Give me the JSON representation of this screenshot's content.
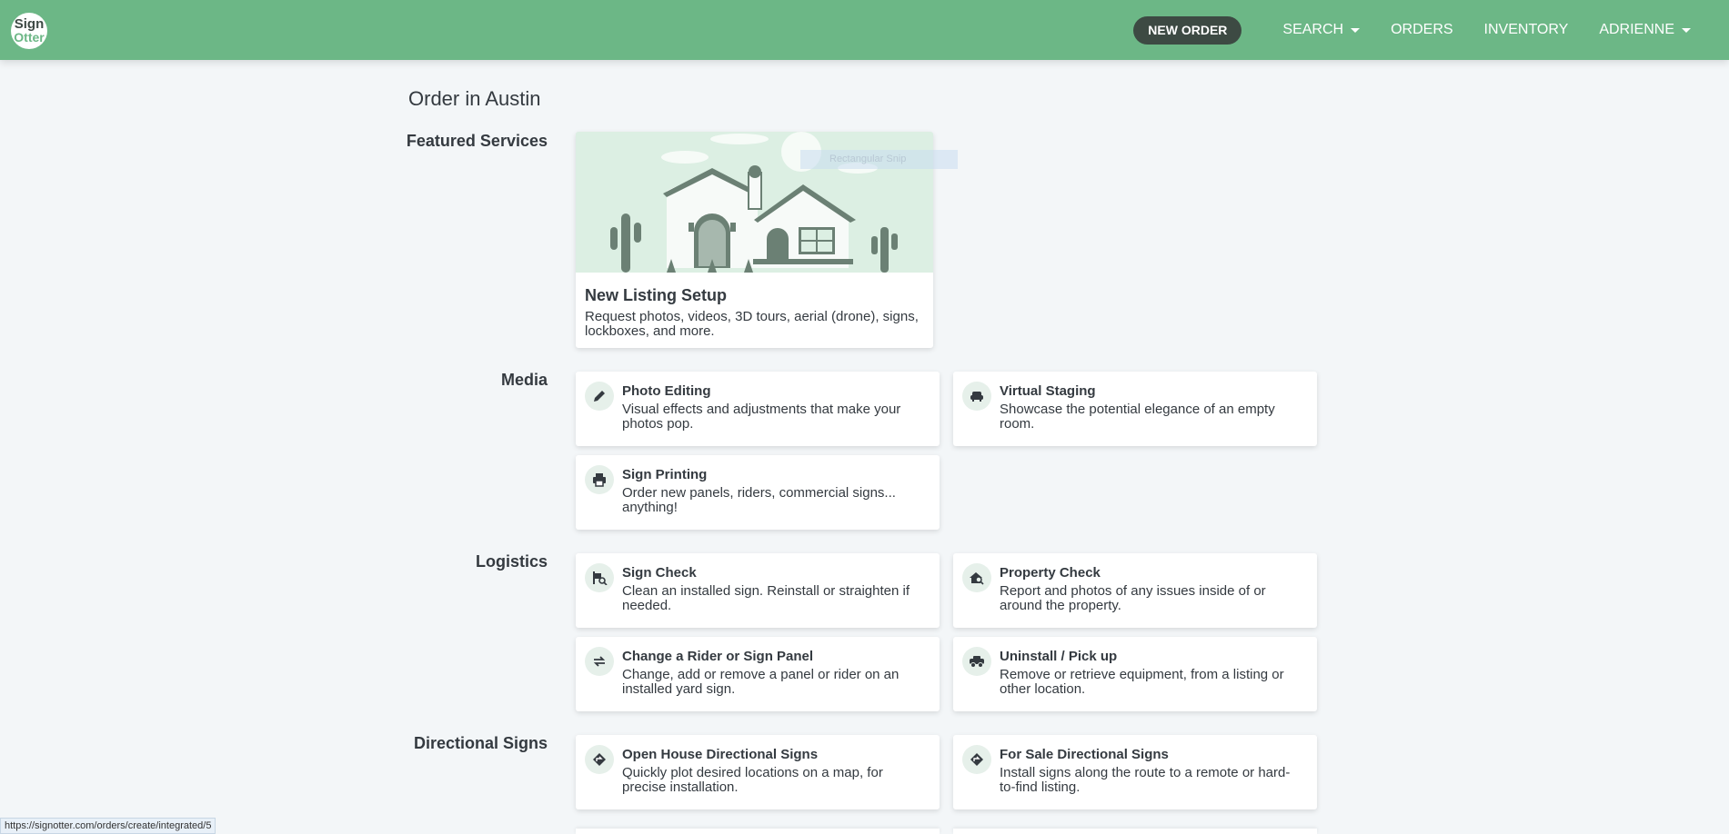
{
  "nav": {
    "logo_line1": "Sign",
    "logo_line2": "Otter",
    "new_order": "NEW ORDER",
    "search": "SEARCH",
    "orders": "ORDERS",
    "inventory": "INVENTORY",
    "user": "ADRIENNE"
  },
  "page": {
    "title": "Order in Austin"
  },
  "sections": {
    "featured": "Featured Services",
    "media": "Media",
    "logistics": "Logistics",
    "directional": "Directional Signs"
  },
  "featured": {
    "title": "New Listing Setup",
    "desc": "Request photos, videos, 3D tours, aerial (drone), signs, lockboxes, and more."
  },
  "overlay": {
    "snip": "Rectangular Snip"
  },
  "cards": {
    "photo_editing": {
      "title": "Photo Editing",
      "desc": "Visual effects and adjustments that make your photos pop.",
      "icon": "pencil-icon"
    },
    "virtual_staging": {
      "title": "Virtual Staging",
      "desc": "Showcase the potential elegance of an empty room.",
      "icon": "sofa-icon"
    },
    "sign_printing": {
      "title": "Sign Printing",
      "desc": "Order new panels, riders, commercial signs... anything!",
      "icon": "printer-icon"
    },
    "sign_check": {
      "title": "Sign Check",
      "desc": "Clean an installed sign. Reinstall or straighten if needed.",
      "icon": "sign-search-icon"
    },
    "property_check": {
      "title": "Property Check",
      "desc": "Report and photos of any issues inside of or around the property.",
      "icon": "house-search-icon"
    },
    "change_rider": {
      "title": "Change a Rider or Sign Panel",
      "desc": "Change, add or remove a panel or rider on an installed yard sign.",
      "icon": "swap-arrows-icon"
    },
    "uninstall": {
      "title": "Uninstall / Pick up",
      "desc": "Remove or retrieve equipment, from a listing or other location.",
      "icon": "truck-icon"
    },
    "open_house": {
      "title": "Open House Directional Signs",
      "desc": "Quickly plot desired locations on a map, for precise installation.",
      "icon": "directions-icon"
    },
    "for_sale": {
      "title": "For Sale Directional Signs",
      "desc": "Install signs along the route to a remote or hard-to-find listing.",
      "icon": "directions-icon"
    }
  },
  "status_bar": "https://signotter.com/orders/create/integrated/5",
  "colors": {
    "navbar": "#6cb786",
    "accent_dark": "#3d4a43",
    "background": "#f3f6f8"
  }
}
